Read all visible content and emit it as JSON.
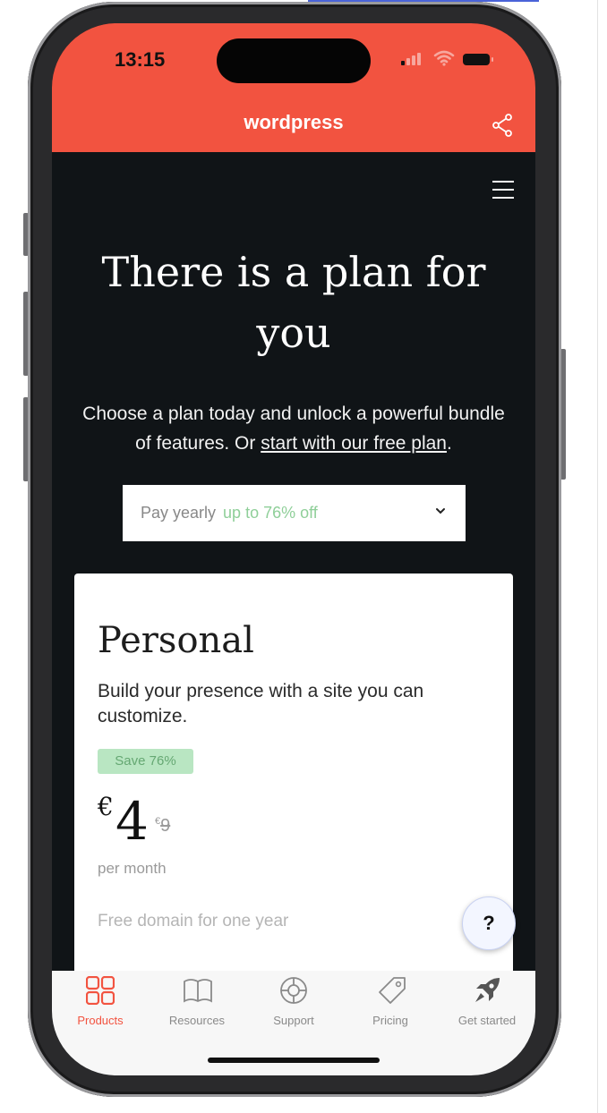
{
  "status": {
    "time": "13:15"
  },
  "header": {
    "title": "wordpress"
  },
  "hero": {
    "title": "There is a plan for you",
    "subtitle_prefix": "Choose a plan today and unlock a powerful bundle of features. Or ",
    "subtitle_link": "start with our free plan",
    "subtitle_suffix": "."
  },
  "billing": {
    "selected": "Pay yearly",
    "discount": "up to 76% off"
  },
  "plan": {
    "name": "Personal",
    "description": "Build your presence with a site you can customize.",
    "badge": "Save 76%",
    "currency": "€",
    "price": "4",
    "old_currency": "€",
    "old_price": "9",
    "period": "per month",
    "feature": "Free domain for one year"
  },
  "help": {
    "label": "?"
  },
  "tabs": [
    {
      "label": "Products",
      "icon": "grid-icon",
      "active": true
    },
    {
      "label": "Resources",
      "icon": "book-icon",
      "active": false
    },
    {
      "label": "Support",
      "icon": "lifebuoy-icon",
      "active": false
    },
    {
      "label": "Pricing",
      "icon": "tag-icon",
      "active": false
    },
    {
      "label": "Get started",
      "icon": "rocket-icon",
      "active": false
    }
  ],
  "colors": {
    "brand": "#f25340",
    "dark_bg": "#101417",
    "save_green": "#b9e6c2"
  }
}
